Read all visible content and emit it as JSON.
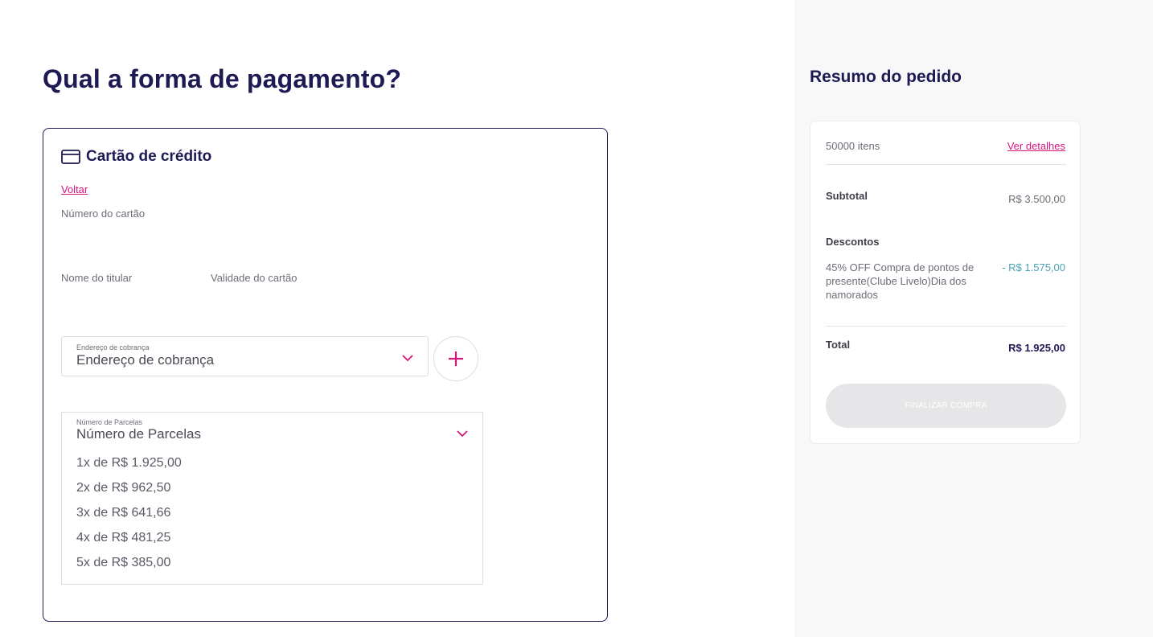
{
  "page": {
    "title": "Qual a forma de pagamento?"
  },
  "payment": {
    "method_label": "Cartão de crédito",
    "back_label": "Voltar",
    "card_number_label": "Número do cartão",
    "holder_name_label": "Nome do titular",
    "expiry_label": "Validade do cartão",
    "billing": {
      "small_label": "Endereço de cobrança",
      "value": "Endereço de cobrança"
    },
    "add_button_symbol": "+",
    "installments": {
      "small_label": "Número de Parcelas",
      "value": "Número de Parcelas",
      "options": [
        "1x de R$ 1.925,00",
        "2x de R$ 962,50",
        "3x de R$ 641,66",
        "4x de R$ 481,25",
        "5x de R$ 385,00"
      ]
    }
  },
  "summary": {
    "title": "Resumo do pedido",
    "items_count": "50000 itens",
    "details_link": "Ver detalhes",
    "subtotal_label": "Subtotal",
    "subtotal_value": "R$ 3.500,00",
    "discounts_label": "Descontos",
    "discount_description": "45% OFF Compra de pontos de presente(Clube Livelo)Dia dos namorados",
    "discount_value": "- R$ 1.575,00",
    "total_label": "Total",
    "total_value": "R$ 1.925,00",
    "finish_button": "FINALIZAR COMPRA"
  },
  "colors": {
    "primary": "#1d1a54",
    "accent": "#d6157d",
    "discount": "#4aa3b5",
    "sidebar_bg": "#f8f8f8",
    "disabled_button": "#e6e6e8"
  },
  "icons": {
    "card": "credit-card-icon",
    "chevron": "chevron-down-icon",
    "add": "plus-icon"
  }
}
